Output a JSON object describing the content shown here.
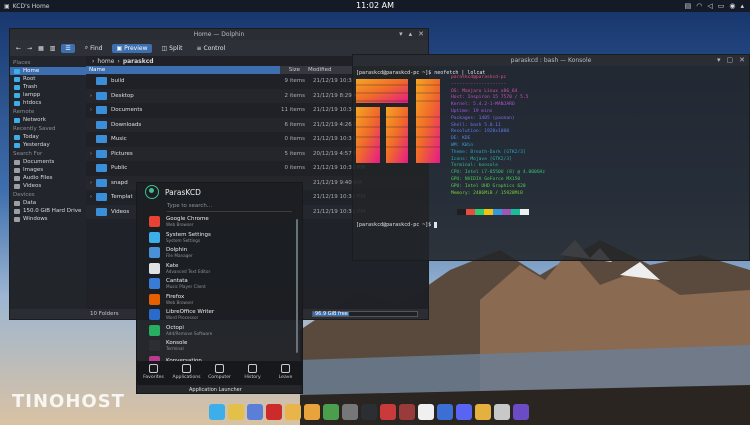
{
  "panel": {
    "title": "KCD's Home",
    "clock": "11:02 AM"
  },
  "dolphin": {
    "title": "Home — Dolphin",
    "toolbar": [
      "Find",
      "Preview",
      "Split",
      "Control"
    ],
    "breadcrumb": [
      "home",
      "paraskcd"
    ],
    "places": {
      "sections": [
        {
          "head": "Places",
          "items": [
            "Home",
            "Root",
            "Trash",
            "lampp",
            "htdocs"
          ]
        },
        {
          "head": "Remote",
          "items": [
            "Network"
          ]
        },
        {
          "head": "Recently Saved",
          "items": [
            "Today",
            "Yesterday"
          ]
        },
        {
          "head": "Search For",
          "items": [
            "Documents",
            "Images",
            "Audio Files",
            "Videos"
          ]
        },
        {
          "head": "Devices",
          "items": [
            "Data",
            "150.0 GiB Hard Drive",
            "Windows"
          ]
        }
      ]
    },
    "columns": {
      "name": "Name",
      "size": "Size",
      "modified": "Modified"
    },
    "files": [
      {
        "name": "build",
        "size": "9 items",
        "date": "21/12/19 10:37 AM"
      },
      {
        "name": "Desktop",
        "size": "2 items",
        "date": "21/12/19 8:29 AM"
      },
      {
        "name": "Documents",
        "size": "11 items",
        "date": "21/12/19 10:31 AM"
      },
      {
        "name": "Downloads",
        "size": "6 items",
        "date": "21/12/19 4:26 PM"
      },
      {
        "name": "Music",
        "size": "0 items",
        "date": "21/12/19 10:30 PM"
      },
      {
        "name": "Pictures",
        "size": "5 items",
        "date": "20/12/19 4:57 PM"
      },
      {
        "name": "Public",
        "size": "0 items",
        "date": "21/12/19 10:30 PM"
      },
      {
        "name": "snapd",
        "size": "",
        "date": "21/12/19 9:40 AM"
      },
      {
        "name": "Templat",
        "size": "",
        "date": "21/12/19 10:30 PM"
      },
      {
        "name": "Videos",
        "size": "",
        "date": "21/12/19 10:30 PM"
      }
    ],
    "status": "10 Folders",
    "free": "96.9 GiB free",
    "free_fraction": 0.35
  },
  "konsole": {
    "title": "paraskcd : bash — Konsole",
    "command": "[paraskcd@paraskcd-pc ~]$ neofetch | lolcat",
    "info": [
      "paraskcd@paraskcd-pc",
      "--------------------",
      "OS: Manjaro Linux x86_64",
      "Host: Inspiron 15 7570 / 5.5",
      "Kernel: 5.4.2-1-MANJARO",
      "Uptime: 19 mins",
      "Packages: 1405 (pacman)",
      "Shell: bash 5.0.11",
      "Resolution: 1920x1080",
      "DE: KDE",
      "WM: KWin",
      "Theme: Breath-Dark [GTK2/3]",
      "Icons: Mojave [GTK2/3]",
      "Terminal: konsole",
      "CPU: Intel i7-8550U (8) @ 4.000GHz",
      "GPU: NVIDIA GeForce MX150",
      "GPU: Intel UHD Graphics 620",
      "Memory: 2486MiB / 15928MiB"
    ],
    "prompt": "[paraskcd@paraskcd-pc ~]$"
  },
  "launcher": {
    "user": "ParasKCD",
    "search_placeholder": "Type to search...",
    "apps": [
      {
        "name": "Google Chrome",
        "desc": "Web Browser",
        "color": "#e94235"
      },
      {
        "name": "System Settings",
        "desc": "System Settings",
        "color": "#3daee9"
      },
      {
        "name": "Dolphin",
        "desc": "File Manager",
        "color": "#4a90d9"
      },
      {
        "name": "Kate",
        "desc": "Advanced Text Editor",
        "color": "#dfe3e6"
      },
      {
        "name": "Cantata",
        "desc": "Music Player Client",
        "color": "#3a7bd5"
      },
      {
        "name": "Firefox",
        "desc": "Web Browser",
        "color": "#e66000"
      },
      {
        "name": "LibreOffice Writer",
        "desc": "Word Processor",
        "color": "#2a6acb"
      },
      {
        "name": "Octopi",
        "desc": "Add/Remove Software",
        "color": "#27ae60"
      },
      {
        "name": "Konsole",
        "desc": "Terminal",
        "color": "#2b2f33"
      },
      {
        "name": "Konversation",
        "desc": "",
        "color": "#b93b8f"
      }
    ],
    "tabs": [
      "Favorites",
      "Applications",
      "Computer",
      "History",
      "Leave"
    ],
    "caption": "Application Launcher"
  },
  "dock": {
    "colors": [
      "#3daee9",
      "#e2c04a",
      "#5b7fd6",
      "#cc2b2b",
      "#e9b44a",
      "#e8a33d",
      "#4b9e4b",
      "#777777",
      "#2b2f33",
      "#c93a3a",
      "#9a3b3b",
      "#f0f0f0",
      "#3b6fd4",
      "#5865f2",
      "#e4b13e",
      "#c8c8c8",
      "#6c4bc7"
    ]
  },
  "watermark": "TINOHOST"
}
